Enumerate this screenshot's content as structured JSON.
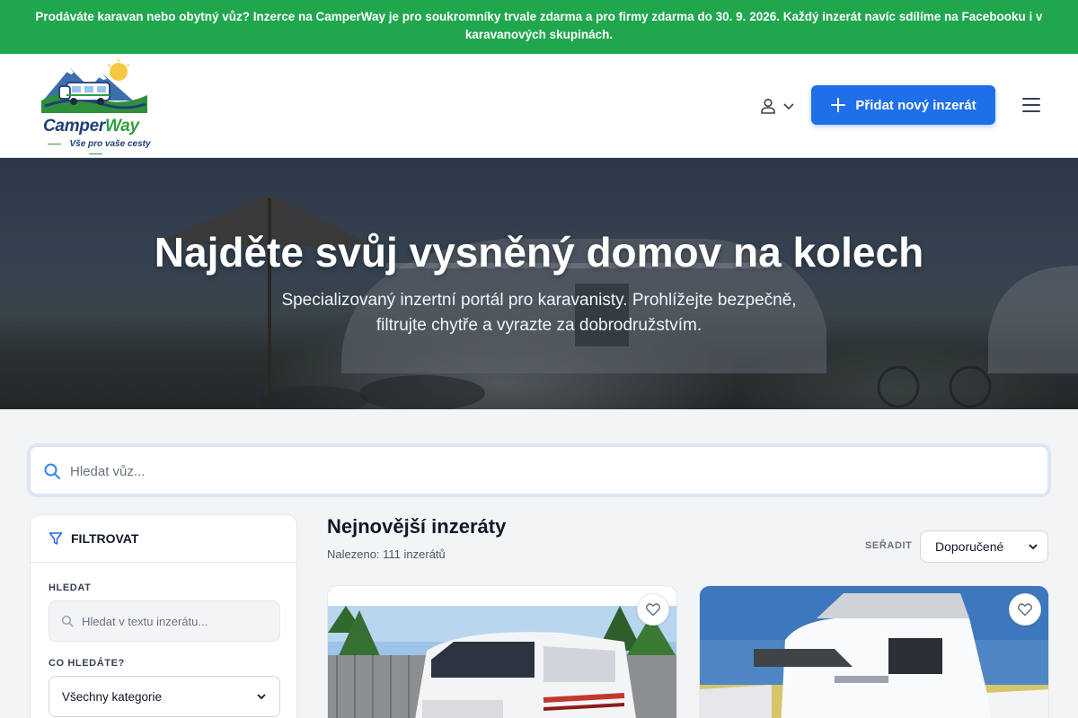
{
  "announcement": {
    "text": "Prodáváte karavan nebo obytný vůz? Inzerce na CamperWay je pro soukromníky trvale zdarma a pro firmy zdarma do 30. 9. 2026. Každý inzerát navíc sdílíme na Facebooku i v karavanových skupinách."
  },
  "header": {
    "logo_name_part1": "Camper",
    "logo_name_part2": "Way",
    "logo_tagline": "Vše pro vaše cesty",
    "add_listing_label": "Přidat nový inzerát",
    "icons": [
      "user-icon",
      "chevron-down-icon",
      "plus-icon",
      "menu-icon"
    ]
  },
  "hero": {
    "title": "Najděte svůj vysněný domov na kolech",
    "subtitle": "Specializovaný inzertní portál pro karavanisty. Prohlížejte bezpečně, filtrujte chytře a vyrazte za dobrodružstvím."
  },
  "search": {
    "placeholder": "Hledat vůz..."
  },
  "filters": {
    "title": "FILTROVAT",
    "search_label": "HLEDAT",
    "search_placeholder": "Hledat v textu inzerátu...",
    "category_label": "CO HLEDÁTE?",
    "category_value": "Všechny kategorie"
  },
  "listings": {
    "title": "Nejnovější inzeráty",
    "count_text": "Nalezeno: 111 inzerátů",
    "sort_label": "SEŘADIT",
    "sort_value": "Doporučené"
  },
  "colors": {
    "accent": "#1f6feb",
    "banner": "#20a74e",
    "brand_blue": "#1f3f79",
    "brand_green": "#2f9e44"
  }
}
